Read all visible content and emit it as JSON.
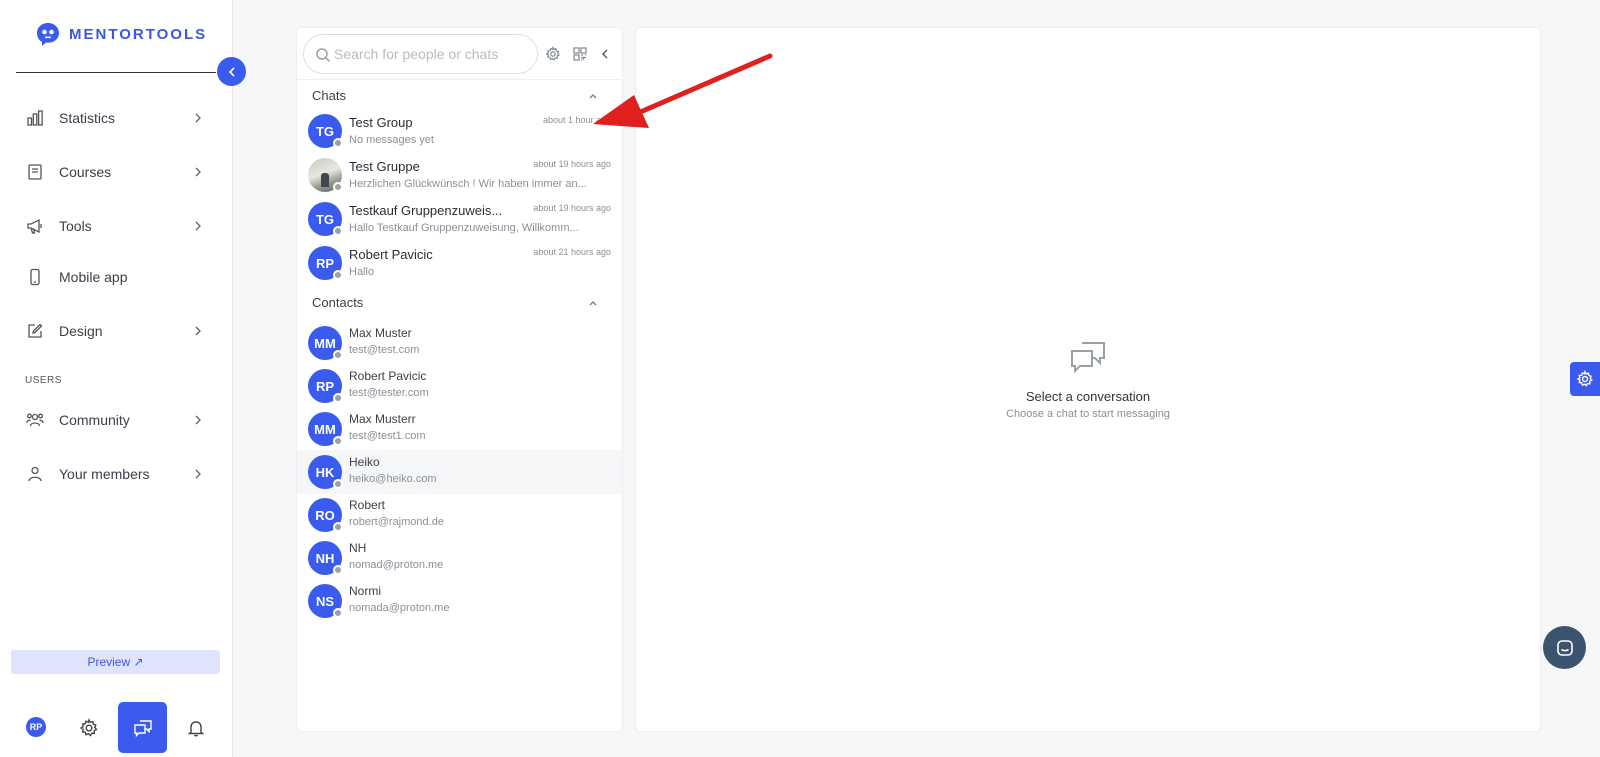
{
  "brand": {
    "name": "MENTORTOOLS",
    "accent": "#3b5bef"
  },
  "sidebar": {
    "items": [
      {
        "label": "Statistics",
        "icon": "bar-chart-icon",
        "has_children": true
      },
      {
        "label": "Courses",
        "icon": "book-icon",
        "has_children": true
      },
      {
        "label": "Tools",
        "icon": "megaphone-icon",
        "has_children": true
      },
      {
        "label": "Mobile app",
        "icon": "phone-icon",
        "has_children": false
      },
      {
        "label": "Design",
        "icon": "pencil-icon",
        "has_children": true
      }
    ],
    "users_section_label": "USERS",
    "user_items": [
      {
        "label": "Community",
        "icon": "people-icon",
        "has_children": true
      },
      {
        "label": "Your members",
        "icon": "person-icon",
        "has_children": true
      }
    ],
    "preview_label": "Preview ↗",
    "user_initials": "RP"
  },
  "chat_list": {
    "search_placeholder": "Search for people or chats",
    "chats_header": "Chats",
    "chats": [
      {
        "initials": "TG",
        "name": "Test Group",
        "last_message": "No messages yet",
        "time": "about 1 hour ago",
        "photo": false
      },
      {
        "initials": "",
        "name": "Test Gruppe",
        "last_message": "Herzlichen Glückwünsch ! Wir haben immer an...",
        "time": "about 19 hours ago",
        "photo": true
      },
      {
        "initials": "TG",
        "name": "Testkauf Gruppenzuweis...",
        "last_message": "Hallo Testkauf Gruppenzuweisung, Willkomm...",
        "time": "about 19 hours ago",
        "photo": false
      },
      {
        "initials": "RP",
        "name": "Robert Pavicic",
        "last_message": "Hallo",
        "time": "about 21 hours ago",
        "photo": false
      }
    ],
    "contacts_header": "Contacts",
    "contacts": [
      {
        "initials": "MM",
        "name": "Max Muster",
        "email": "test@test.com"
      },
      {
        "initials": "RP",
        "name": "Robert Pavicic",
        "email": "test@tester.com"
      },
      {
        "initials": "MM",
        "name": "Max Musterr",
        "email": "test@test1.com"
      },
      {
        "initials": "HK",
        "name": "Heiko",
        "email": "heiko@heiko.com"
      },
      {
        "initials": "RO",
        "name": "Robert",
        "email": "robert@rajmond.de"
      },
      {
        "initials": "NH",
        "name": "NH",
        "email": "nomad@proton.me"
      },
      {
        "initials": "NS",
        "name": "Normi",
        "email": "nomada@proton.me"
      }
    ]
  },
  "conversation": {
    "empty_title": "Select a conversation",
    "empty_subtitle": "Choose a chat to start messaging"
  }
}
